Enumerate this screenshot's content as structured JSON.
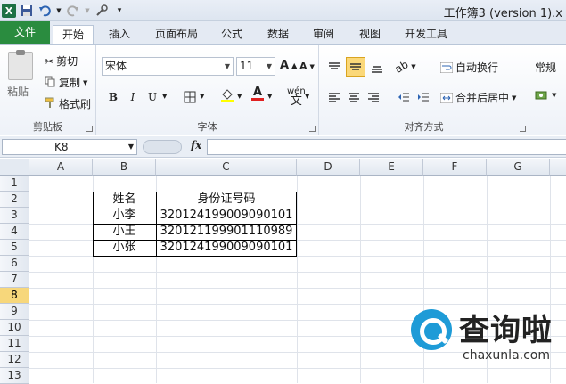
{
  "title_bar": {
    "title": "工作簿3 (version 1).x"
  },
  "tabs": [
    {
      "label": "文件"
    },
    {
      "label": "开始"
    },
    {
      "label": "插入"
    },
    {
      "label": "页面布局"
    },
    {
      "label": "公式"
    },
    {
      "label": "数据"
    },
    {
      "label": "审阅"
    },
    {
      "label": "视图"
    },
    {
      "label": "开发工具"
    }
  ],
  "ribbon": {
    "clipboard": {
      "paste": "粘贴",
      "cut": "剪切",
      "copy": "复制",
      "format_painter": "格式刷",
      "group": "剪贴板"
    },
    "font": {
      "name": "宋体",
      "size": "11",
      "group": "字体",
      "bold": "B",
      "italic": "I",
      "underline": "U",
      "wen": "wén"
    },
    "alignment": {
      "wrap": "自动换行",
      "merge": "合并后居中",
      "group": "对齐方式"
    },
    "number": {
      "format": "常规"
    }
  },
  "formula_bar": {
    "name_box": "K8",
    "fx": "fx",
    "value": ""
  },
  "columns": [
    "A",
    "B",
    "C",
    "D",
    "E",
    "F",
    "G"
  ],
  "rows": [
    "1",
    "2",
    "3",
    "4",
    "5",
    "6",
    "7",
    "8",
    "9",
    "10",
    "11",
    "12",
    "13"
  ],
  "selected_row": "8",
  "table": {
    "header": [
      "姓名",
      "身份证号码"
    ],
    "rows": [
      [
        "小李",
        "320124199009090101"
      ],
      [
        "小王",
        "320121199901110989"
      ],
      [
        "小张",
        "320124199009090101"
      ]
    ]
  },
  "watermark": {
    "cn": "查询啦",
    "en": "chaxunla.com"
  },
  "colors": {
    "file_tab": "#2a8c3f",
    "selected_row": "#f7d77b",
    "watermark_blue": "#1e9bd7"
  }
}
